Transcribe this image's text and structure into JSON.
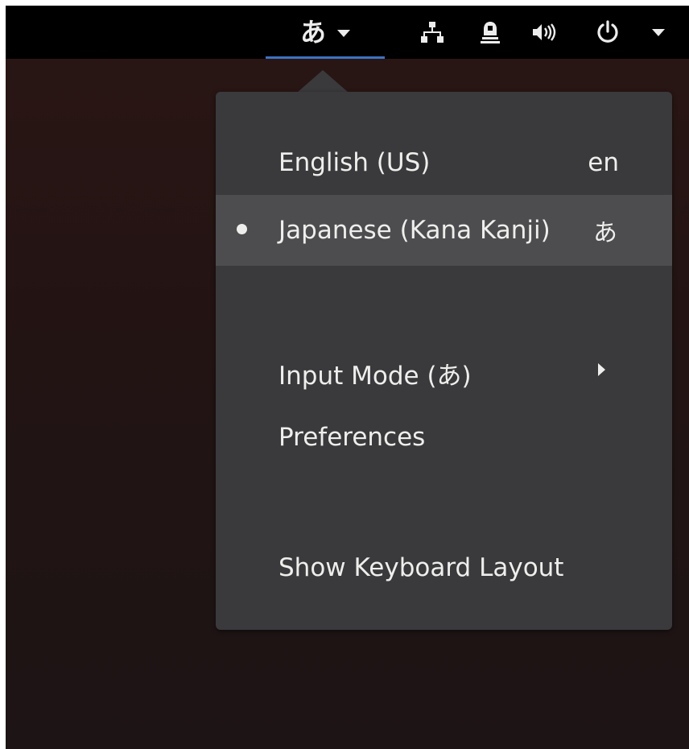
{
  "topbar": {
    "ime_glyph": "あ",
    "icons": [
      "caret-down-icon",
      "network-icon",
      "notification-icon",
      "volume-icon",
      "power-icon",
      "caret-down-icon"
    ]
  },
  "menu": {
    "sources": [
      {
        "label": "English (US)",
        "code": "en",
        "selected": false
      },
      {
        "label": "Japanese (Kana Kanji)",
        "code": "あ",
        "selected": true
      }
    ],
    "input_mode_label": "Input Mode (あ)",
    "preferences_label": "Preferences",
    "show_layout_label": "Show Keyboard Layout"
  },
  "colors": {
    "topbar_bg": "#000000",
    "menu_bg": "#3a3a3c",
    "selected_row_bg": "#4d4d4f",
    "accent_underline": "#3c73c4",
    "text": "#eeeeec"
  }
}
